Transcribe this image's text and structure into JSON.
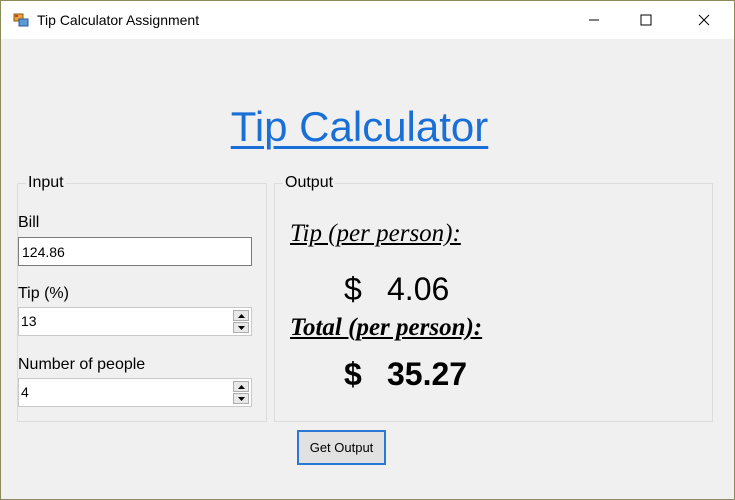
{
  "window": {
    "title": "Tip Calculator Assignment"
  },
  "heading": "Tip Calculator",
  "input": {
    "legend": "Input",
    "bill_label": "Bill",
    "bill_value": "124.86",
    "tip_label": "Tip (%)",
    "tip_value": "13",
    "people_label": "Number of people",
    "people_value": "4"
  },
  "output": {
    "legend": "Output",
    "tip_label": "Tip (per person):",
    "tip_currency": "$",
    "tip_value": "4.06",
    "total_label": "Total (per person):",
    "total_currency": "$",
    "total_value": "35.27"
  },
  "button": {
    "get_output": "Get Output"
  },
  "colors": {
    "heading": "#1a6fd6",
    "button_border": "#2b78d4",
    "background": "#f0f0f0"
  }
}
